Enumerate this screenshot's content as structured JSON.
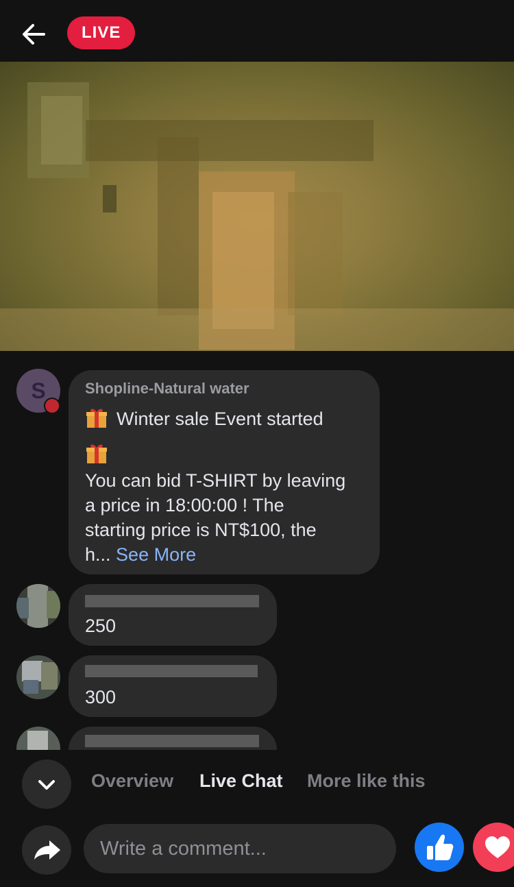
{
  "header": {
    "live_label": "LIVE"
  },
  "comments": [
    {
      "author": "Shopline-Natural water",
      "line1": "Winter sale Event started",
      "line3": "You can bid T-SHIRT by leaving",
      "line4": "a price in 18:00:00 ! The",
      "line5": "starting price is NT$100, the",
      "line6_prefix": "h...",
      "see_more": "See More"
    },
    {
      "author": "",
      "text": "250"
    },
    {
      "author": "",
      "text": "300"
    }
  ],
  "tabs": [
    "Overview",
    "Live Chat",
    "More like this"
  ],
  "active_tab": "Live Chat",
  "composer": {
    "placeholder": "Write a comment..."
  },
  "colors": {
    "live": "#e41e3f",
    "like": "#1877f2",
    "love": "#f33e58",
    "link": "#8ab4f8"
  }
}
